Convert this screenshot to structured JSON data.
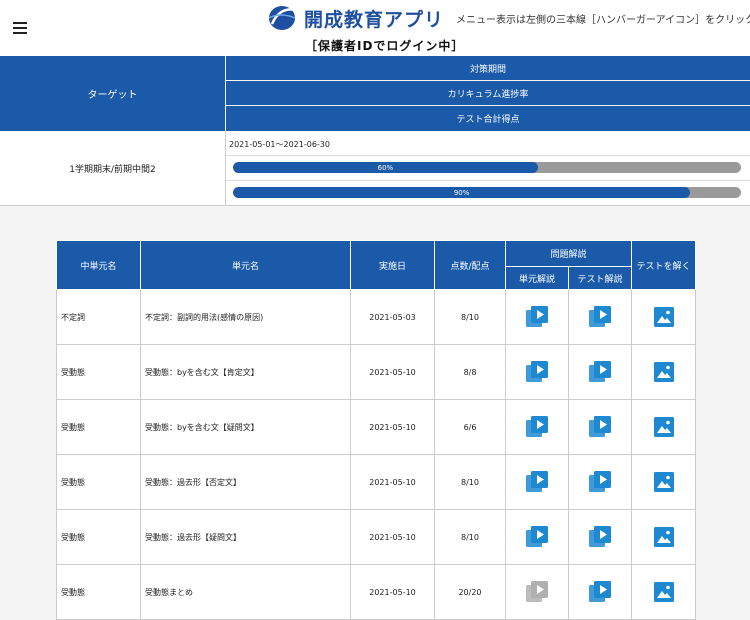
{
  "header": {
    "app_title": "開成教育アプリ",
    "menu_hint": "メニュー表示は左側の三本線［ハンバーガーアイコン］をクリック",
    "login_status": "［保護者IDでログイン中］"
  },
  "summary": {
    "target_label": "ターゲット",
    "period_label": "対策期間",
    "curriculum_label": "カリキュラム進捗率",
    "test_label": "テスト合計得点",
    "term_name": "1学期期末/前期中間2",
    "period_value": "2021-05-01～2021-06-30",
    "curriculum_progress": {
      "value": 0.6,
      "label": "60%"
    },
    "test_score": {
      "value": 0.9,
      "label": "90%"
    }
  },
  "units_table": {
    "headers": {
      "middle_unit": "中単元名",
      "unit": "単元名",
      "date": "実施日",
      "score": "点数/配点",
      "explanation": "問題解説",
      "unit_explanation": "単元解説",
      "test_explanation": "テスト解説",
      "solve_test": "テストを解く"
    },
    "rows": [
      {
        "middle_unit": "不定詞",
        "unit": "不定詞：副詞的用法(感情の原因)",
        "date": "2021-05-03",
        "score": "8/10",
        "unit_video": "enabled"
      },
      {
        "middle_unit": "受動態",
        "unit": "受動態：byを含む文【肯定文】",
        "date": "2021-05-10",
        "score": "8/8",
        "unit_video": "enabled"
      },
      {
        "middle_unit": "受動態",
        "unit": "受動態：byを含む文【疑問文】",
        "date": "2021-05-10",
        "score": "6/6",
        "unit_video": "enabled"
      },
      {
        "middle_unit": "受動態",
        "unit": "受動態：過去形【否定文】",
        "date": "2021-05-10",
        "score": "8/10",
        "unit_video": "enabled"
      },
      {
        "middle_unit": "受動態",
        "unit": "受動態：過去形【疑問文】",
        "date": "2021-05-10",
        "score": "8/10",
        "unit_video": "enabled"
      },
      {
        "middle_unit": "受動態",
        "unit": "受動態まとめ",
        "date": "2021-05-10",
        "score": "20/20",
        "unit_video": "disabled"
      }
    ]
  },
  "colors": {
    "header_blue": "#1a5aa8",
    "bar_gray": "#9a9a9a",
    "icon_blue": "#1e88d0",
    "icon_disabled": "#b0b0b0"
  }
}
